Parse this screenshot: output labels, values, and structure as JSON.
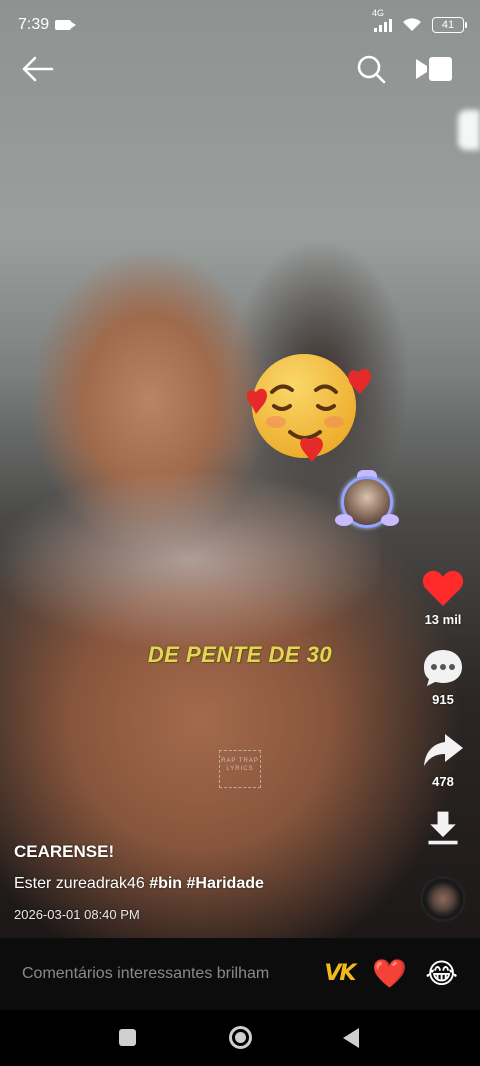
{
  "status_bar": {
    "time": "7:39",
    "network": "4G",
    "battery": "41"
  },
  "top_nav": {
    "back_icon": "arrow-left-icon",
    "search_icon": "search-icon",
    "screen_icon": "cast-screen-icon"
  },
  "video": {
    "caption": "DE PENTE DE 30",
    "watermark": "RAP TRAP LYRICS",
    "sticker": "smiling-face-with-hearts-emoji"
  },
  "actions": {
    "avatar_icon": "creator-avatar-icon",
    "likes": "13 mil",
    "comments": "915",
    "shares": "478",
    "download_icon": "download-icon",
    "music_icon": "music-disc-icon",
    "like_color": "#ff2b2b"
  },
  "post": {
    "username": "CEARENSE!",
    "description_text": "Ester zureadrak46",
    "hashtag_1": "#bin",
    "hashtag_2": "#Haridade",
    "date": "2026-03-01 08:40 PM"
  },
  "comment_bar": {
    "placeholder": "Comentários interessantes brilham",
    "quick_1": "VK",
    "quick_2": "❤️",
    "quick_3": "😂"
  },
  "system_nav": {
    "recent_icon": "recent-apps-icon",
    "home_icon": "home-icon",
    "back_icon": "back-triangle-icon"
  }
}
